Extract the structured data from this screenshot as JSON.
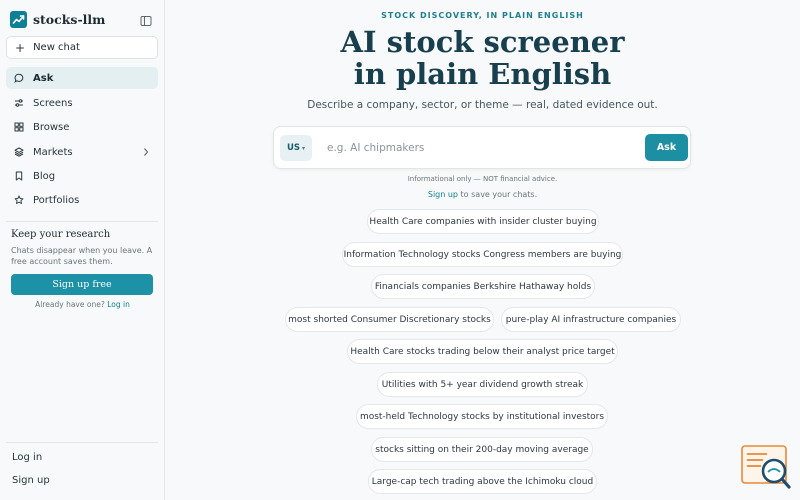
{
  "app": {
    "name": "stocks-llm"
  },
  "sidebar": {
    "new_chat": "New chat",
    "items": [
      {
        "label": "Ask",
        "icon": "chat-bubble-icon"
      },
      {
        "label": "Screens",
        "icon": "sliders-icon"
      },
      {
        "label": "Browse",
        "icon": "grid-icon"
      },
      {
        "label": "Markets",
        "icon": "layers-icon"
      },
      {
        "label": "Blog",
        "icon": "bookmark-icon"
      },
      {
        "label": "Portfolios",
        "icon": "star-icon"
      }
    ],
    "keep": {
      "title": "Keep your research",
      "desc": "Chats disappear when you leave. A free account saves them.",
      "button": "Sign up free",
      "already": "Already have one?",
      "login_link": "Log in"
    },
    "bottom": {
      "login": "Log in",
      "signup": "Sign up"
    }
  },
  "main": {
    "eyebrow": "STOCK DISCOVERY, IN PLAIN ENGLISH",
    "title_line1": "AI stock screener",
    "title_line2": "in plain English",
    "subtitle": "Describe a company, sector, or theme — real, dated evidence out.",
    "search": {
      "market": "US",
      "placeholder": "e.g. AI chipmakers",
      "button": "Ask"
    },
    "disclaimer": "Informational only — NOT financial advice.",
    "signup_link": "Sign up",
    "signup_rest": " to save your chats.",
    "suggestions": [
      "Health Care companies with insider cluster buying",
      "Information Technology stocks Congress members are buying",
      "Financials companies Berkshire Hathaway holds",
      "most shorted Consumer Discretionary stocks",
      "pure-play AI infrastructure companies",
      "Health Care stocks trading below their analyst price target",
      "Utilities with 5+ year dividend growth streak",
      "most-held Technology stocks by institutional investors",
      "stocks sitting on their 200-day moving average",
      "Large-cap tech trading above the Ichimoku cloud"
    ]
  },
  "colors": {
    "accent": "#1d8fa3",
    "title": "#173f4e",
    "eyebrow": "#1f7f8f"
  }
}
